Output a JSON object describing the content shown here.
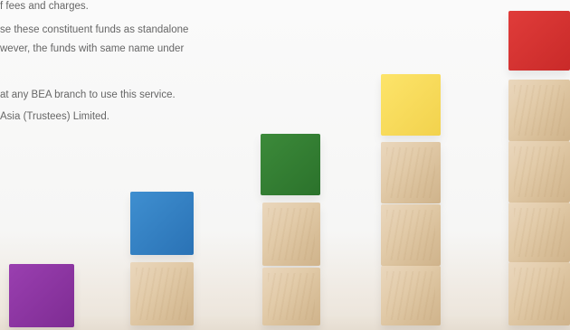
{
  "text_lines": [
    "f fees and charges.",
    "se these constituent funds as standalone",
    "wever, the funds with same name under",
    "",
    "at any BEA branch to use this service.",
    "Asia (Trustees) Limited."
  ],
  "image": {
    "alt": "stacked wooden blocks with colored blocks",
    "block_colors": {
      "purple": "#8b35a2",
      "blue": "#3580c4",
      "green": "#338233",
      "yellow": "#f8db5c",
      "red": "#d83332",
      "wood": "#dfc6a3"
    }
  }
}
